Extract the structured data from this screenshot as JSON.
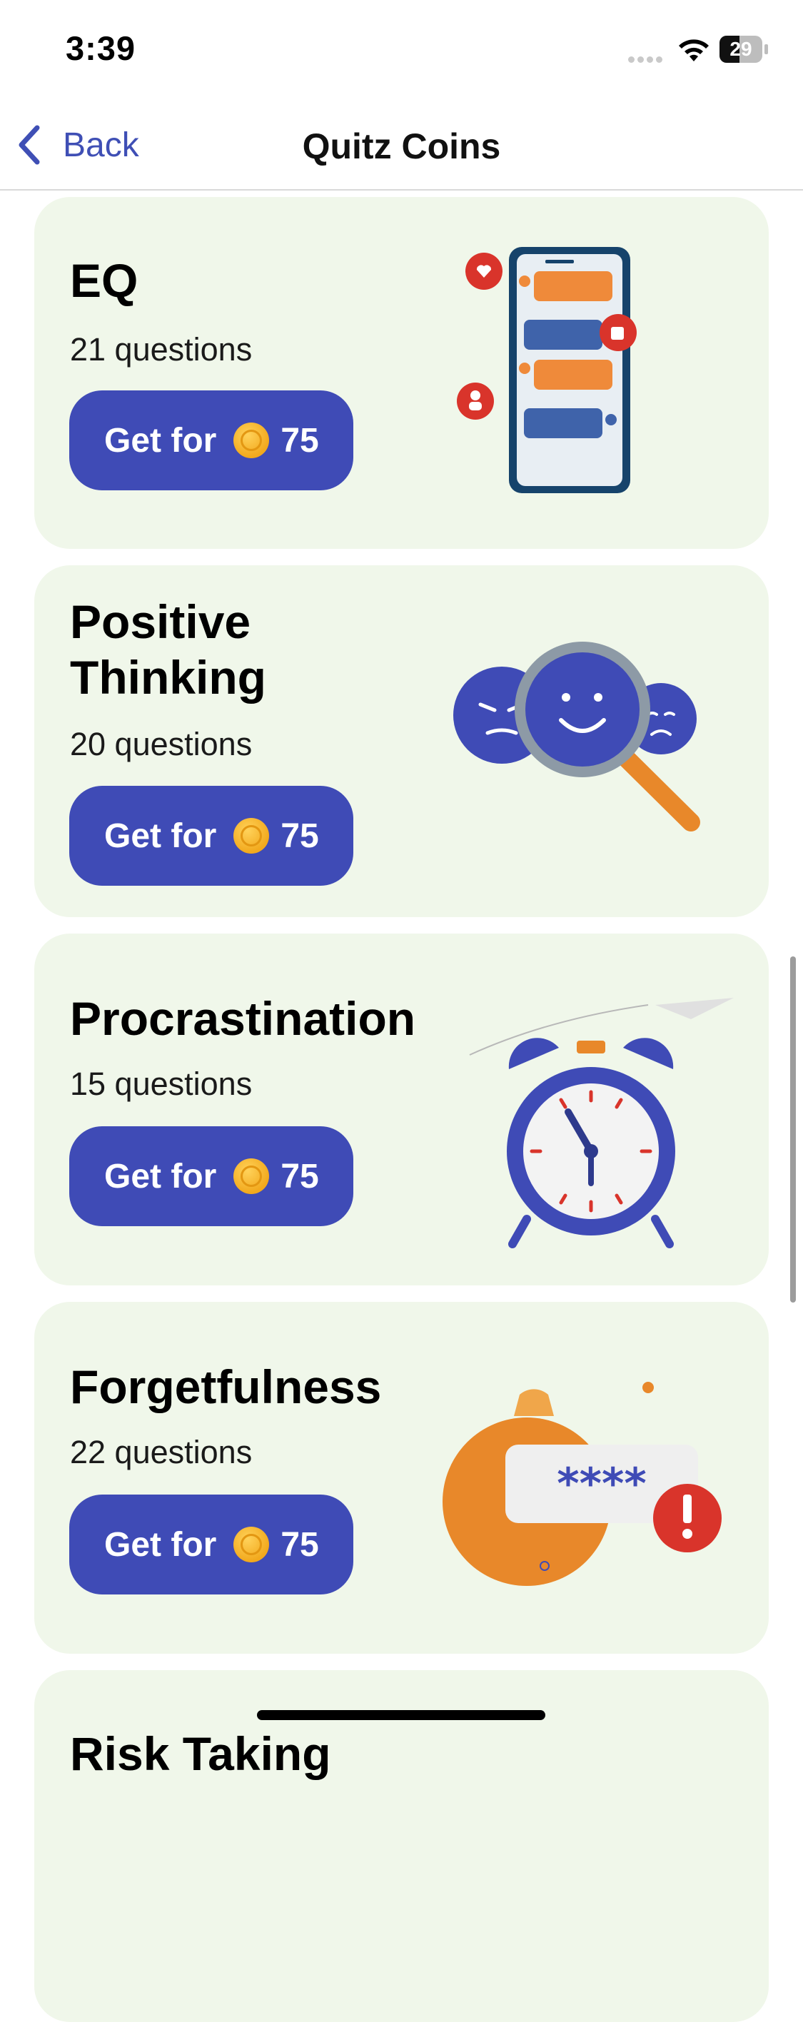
{
  "status_bar": {
    "time": "3:39",
    "battery": "29"
  },
  "nav": {
    "back_label": "Back",
    "title": "Quitz Coins"
  },
  "cards": [
    {
      "title": "EQ",
      "questions": "21 questions",
      "button_label": "Get for",
      "price": "75"
    },
    {
      "title_line1": "Positive",
      "title_line2": "Thinking",
      "questions": "20 questions",
      "button_label": "Get for",
      "price": "75"
    },
    {
      "title": "Procrastination",
      "questions": "15 questions",
      "button_label": "Get for",
      "price": "75"
    },
    {
      "title": "Forgetfulness",
      "questions": "22 questions",
      "button_label": "Get for",
      "price": "75"
    },
    {
      "title": "Risk Taking"
    }
  ],
  "illustrations": [
    "chat-phone-icon",
    "magnifier-faces-icon",
    "alarm-clock-icon",
    "password-alert-icon"
  ],
  "colors": {
    "accent": "#3f4bb6",
    "card_bg": "#f0f7ea",
    "coin": "#f2a91d",
    "back_link": "#3f4fb5"
  }
}
